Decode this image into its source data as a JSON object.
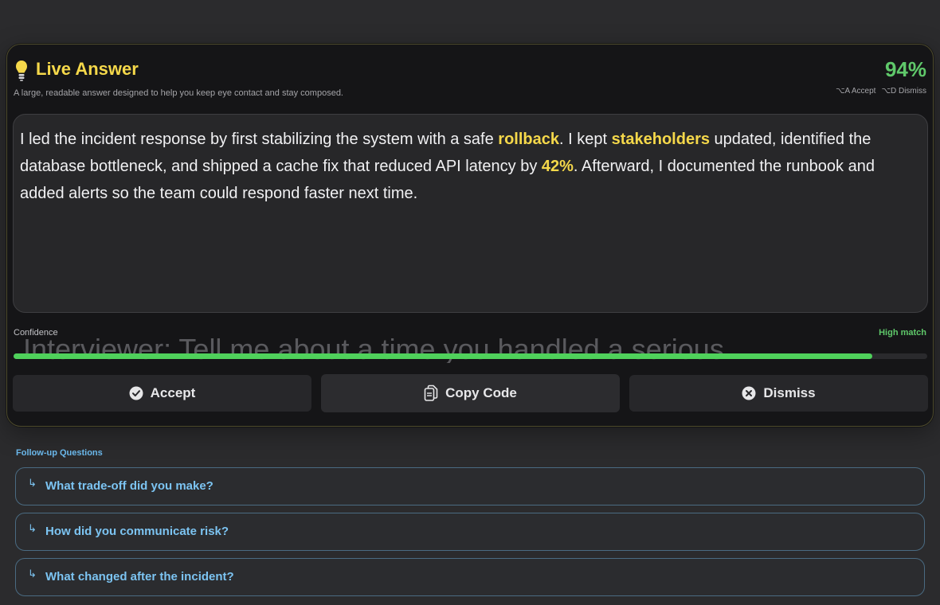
{
  "header": {
    "icon": "lightbulb-icon",
    "title": "Live Answer",
    "subtitle": "A large, readable answer designed to help you keep eye contact and stay composed.",
    "confidence_percent": "94%",
    "shortcut_accept": "⌥A Accept",
    "shortcut_dismiss": "⌥D Dismiss",
    "accent_color": "#f5d84a"
  },
  "answer": {
    "seg1": "I led the incident response by first stabilizing the system with a safe ",
    "hl1": "rollback",
    "seg2": ". I kept ",
    "hl2": "stakeholders",
    "seg3": " updated, identified the database bottleneck, and shipped a cache fix that reduced API latency by ",
    "hl3": "42%",
    "seg4": ". Afterward, I documented the runbook and added alerts so the team could respond faster next time."
  },
  "confidence": {
    "label": "Confidence",
    "match_label": "High match",
    "value": 0.94,
    "bar_color": "#4fd15b"
  },
  "transcript_ghost": "Interviewer: Tell me about a time you handled a serious pro",
  "actions": {
    "accept": "Accept",
    "copy": "Copy Code",
    "dismiss": "Dismiss"
  },
  "followups": {
    "title": "Follow-up Questions",
    "items": [
      {
        "label": "What trade-off did you make?"
      },
      {
        "label": "How did you communicate risk?"
      },
      {
        "label": "What changed after the incident?"
      }
    ]
  }
}
